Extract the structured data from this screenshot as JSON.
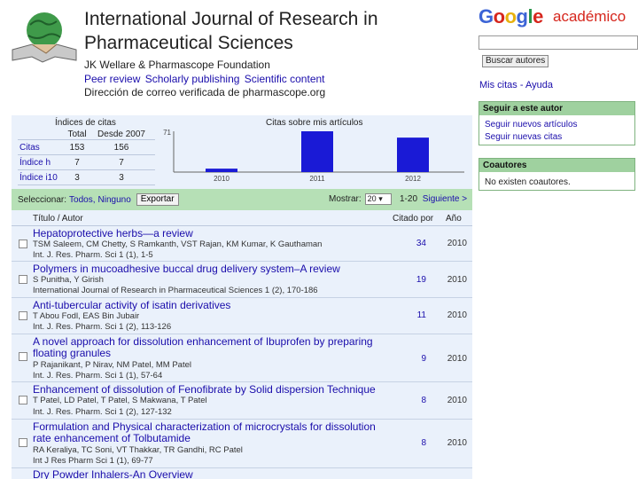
{
  "journal": {
    "title": "International Journal of Research in Pharmaceutical Sciences",
    "affiliation": "JK Wellare & Pharmascope Foundation",
    "tags": [
      "Peer review",
      "Scholarly publishing",
      "Scientific content"
    ],
    "email": "Dirección de correo verificada de pharmascope.org"
  },
  "scholar": {
    "logo": "Google",
    "logo_suffix": "académico",
    "search_button": "Buscar autores",
    "my_cites": "Mis citas - Ayuda"
  },
  "citations": {
    "title": "Índices de citas",
    "headers": [
      "",
      "Total",
      "Desde 2007"
    ],
    "rows": [
      {
        "label": "Citas",
        "total": "153",
        "since": "156"
      },
      {
        "label": "Índice h",
        "total": "7",
        "since": "7"
      },
      {
        "label": "Índice i10",
        "total": "3",
        "since": "3"
      }
    ]
  },
  "chart_data": {
    "type": "bar",
    "title": "Citas sobre mis artículos",
    "categories": [
      "2010",
      "2011",
      "2012"
    ],
    "values": [
      6,
      71,
      60
    ],
    "ylim": [
      0,
      71
    ],
    "yticks": [
      "71"
    ],
    "color": "#1a1ad6"
  },
  "follow": {
    "title": "Seguir a este autor",
    "links": [
      "Seguir nuevos artículos",
      "Seguir nuevas citas"
    ]
  },
  "coauthors": {
    "title": "Coautores",
    "empty": "No existen coautores."
  },
  "toolbar": {
    "select_label": "Seleccionar:",
    "all": "Todos,",
    "none": "Ninguno",
    "export": "Exportar",
    "show_label": "Mostrar:",
    "show_value": "20",
    "range": "1-20",
    "next": "Siguiente >"
  },
  "list_header": {
    "title": "Título / Autor",
    "cited": "Citado por",
    "year": "Año"
  },
  "articles": [
    {
      "title": "Hepatoprotective herbs—a review",
      "authors": "TSM Saleem, CM Chetty, S Ramkanth, VST Rajan, KM Kumar, K Gauthaman",
      "venue": "Int. J. Res. Pharm. Sci 1 (1), 1-5",
      "cited": "34",
      "year": "2010"
    },
    {
      "title": "Polymers in mucoadhesive buccal drug delivery system–A review",
      "authors": "S Punitha, Y Girish",
      "venue": "International Journal of Research in Pharmaceutical Sciences 1 (2), 170-186",
      "cited": "19",
      "year": "2010"
    },
    {
      "title": "Anti-tubercular activity of isatin derivatives",
      "authors": "T Abou Fodl, EAS Bin Jubair",
      "venue": "Int. J. Res. Pharm. Sci 1 (2), 113-126",
      "cited": "11",
      "year": "2010"
    },
    {
      "title": "A novel approach for dissolution enhancement of Ibuprofen by preparing floating granules",
      "authors": "P Rajanikant, P Nirav, NM Patel, MM Patel",
      "venue": "Int. J. Res. Pharm. Sci 1 (1), 57-64",
      "cited": "9",
      "year": "2010"
    },
    {
      "title": "Enhancement of dissolution of Fenofibrate by Solid dispersion Technique",
      "authors": "T Patel, LD Patel, T Patel, S Makwana, T Patel",
      "venue": "Int. J. Res. Pharm. Sci 1 (2), 127-132",
      "cited": "8",
      "year": "2010"
    },
    {
      "title": "Formulation and Physical characterization of microcrystals for dissolution rate enhancement of Tolbutamide",
      "authors": "RA Keraliya, TC Soni, VT Thakkar, TR Gandhi, RC Patel",
      "venue": "Int J Res Pharm Sci 1 (1), 69-77",
      "cited": "8",
      "year": "2010"
    },
    {
      "title": "Dry Powder Inhalers-An Overview",
      "authors": "",
      "venue": "",
      "cited": "",
      "year": ""
    }
  ]
}
